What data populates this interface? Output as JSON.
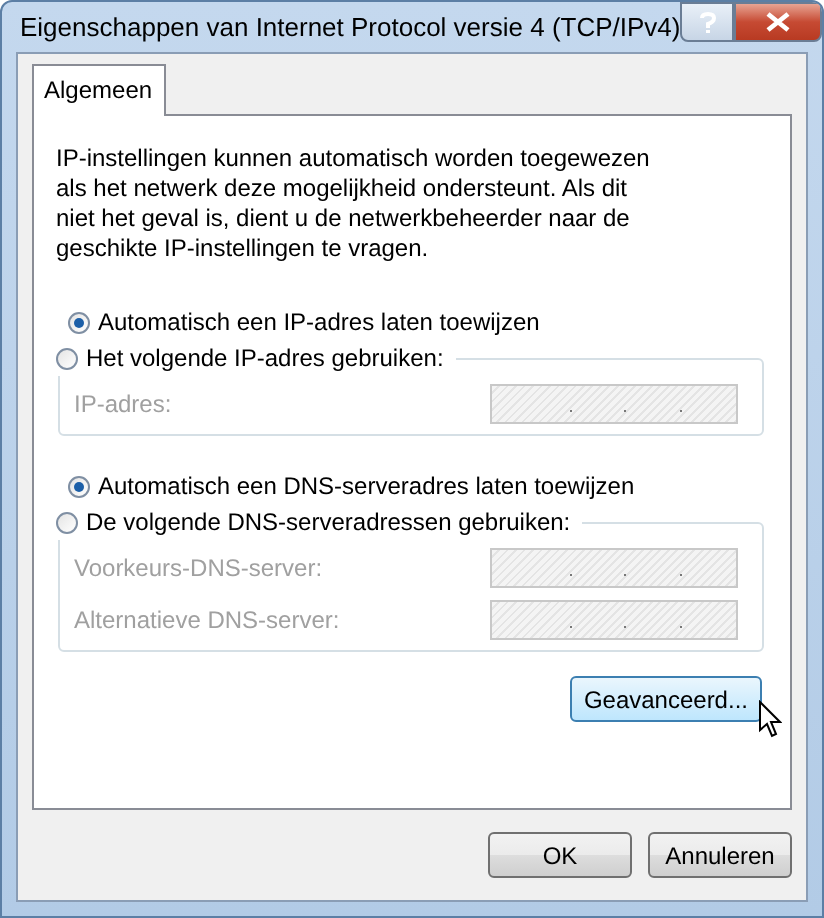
{
  "window": {
    "title": "Eigenschappen van Internet Protocol versie 4 (TCP/IPv4)"
  },
  "tabs": [
    {
      "label": "Algemeen",
      "selected": true
    }
  ],
  "description": "IP-instellingen kunnen automatisch worden toegewezen als het netwerk deze mogelijkheid ondersteunt. Als dit niet het geval is, dient u de netwerkbeheerder naar de geschikte IP-instellingen te vragen.",
  "sections": [
    {
      "options": [
        {
          "label": "Automatisch een IP-adres laten toewijzen",
          "selected": true
        },
        {
          "label": "Het volgende IP-adres gebruiken:",
          "selected": false
        }
      ],
      "fields": [
        {
          "label": "IP-adres:",
          "disabled": true
        }
      ]
    },
    {
      "options": [
        {
          "label": "Automatisch een DNS-serveradres laten toewijzen",
          "selected": true
        },
        {
          "label": "De volgende DNS-serveradressen gebruiken:",
          "selected": false
        }
      ],
      "fields": [
        {
          "label": "Voorkeurs-DNS-server:",
          "disabled": true
        },
        {
          "label": "Alternatieve DNS-server:",
          "disabled": true
        }
      ]
    }
  ],
  "advanced_button": {
    "label": "Geavanceerd...",
    "hovered": true
  },
  "buttons": [
    {
      "label": "OK"
    },
    {
      "label": "Annuleren"
    }
  ]
}
